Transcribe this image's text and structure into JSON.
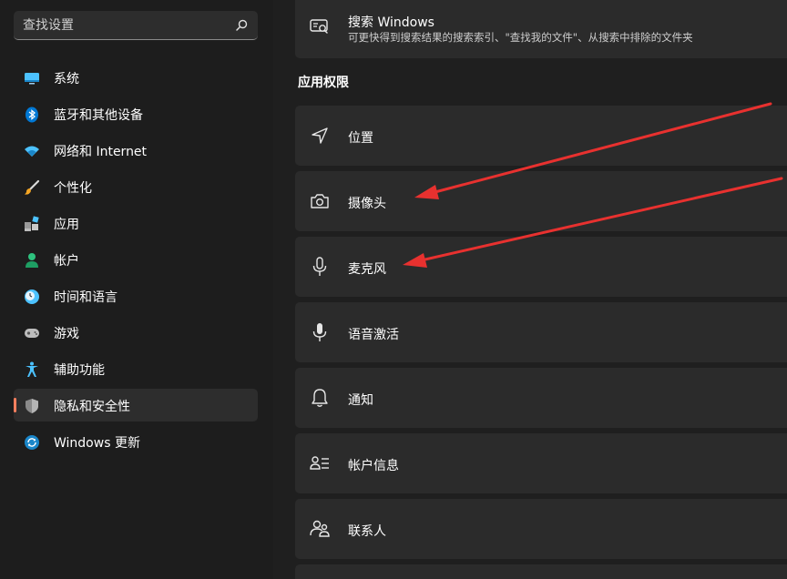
{
  "search": {
    "placeholder": "查找设置"
  },
  "sidebar": {
    "items": [
      {
        "label": "系统",
        "icon": "monitor-icon"
      },
      {
        "label": "蓝牙和其他设备",
        "icon": "bluetooth-icon"
      },
      {
        "label": "网络和 Internet",
        "icon": "wifi-icon"
      },
      {
        "label": "个性化",
        "icon": "brush-icon"
      },
      {
        "label": "应用",
        "icon": "apps-icon"
      },
      {
        "label": "帐户",
        "icon": "account-icon"
      },
      {
        "label": "时间和语言",
        "icon": "clock-globe-icon"
      },
      {
        "label": "游戏",
        "icon": "gamepad-icon"
      },
      {
        "label": "辅助功能",
        "icon": "accessibility-icon"
      },
      {
        "label": "隐私和安全性",
        "icon": "shield-icon",
        "active": true
      },
      {
        "label": "Windows 更新",
        "icon": "update-icon"
      }
    ]
  },
  "main": {
    "search_windows": {
      "title": "搜索 Windows",
      "subtitle": "可更快得到搜索结果的搜索索引、\"查找我的文件\"、从搜索中排除的文件夹",
      "icon": "search-windows-icon"
    },
    "section_heading": "应用权限",
    "permissions": [
      {
        "label": "位置",
        "icon": "location-icon"
      },
      {
        "label": "摄像头",
        "icon": "camera-icon"
      },
      {
        "label": "麦克风",
        "icon": "microphone-icon"
      },
      {
        "label": "语音激活",
        "icon": "voice-activation-icon"
      },
      {
        "label": "通知",
        "icon": "bell-icon"
      },
      {
        "label": "帐户信息",
        "icon": "account-info-icon"
      },
      {
        "label": "联系人",
        "icon": "contacts-icon"
      }
    ]
  },
  "colors": {
    "accent": "#ff7f5e",
    "arrow": "#e8312f",
    "card": "#2b2b2b",
    "background": "#1f1f1f"
  }
}
